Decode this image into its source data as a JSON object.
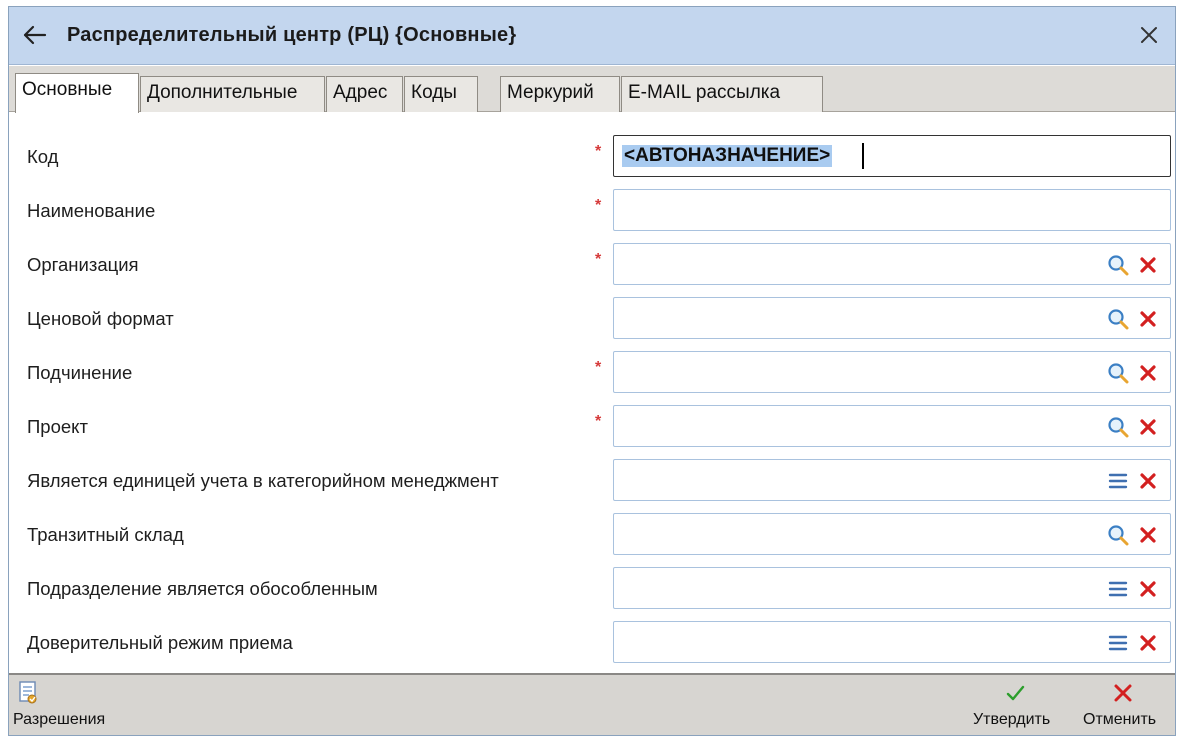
{
  "window": {
    "title": "Распределительный центр (РЦ) {Основные}",
    "back_icon": "arrow-left-icon",
    "close_icon": "close-icon"
  },
  "tabs": [
    {
      "label": "Основные",
      "active": true
    },
    {
      "label": "Дополнительные",
      "active": false
    },
    {
      "label": "Адрес",
      "active": false
    },
    {
      "label": "Коды",
      "active": false
    },
    {
      "label": "Меркурий",
      "active": false
    },
    {
      "label": "E-MAIL рассылка",
      "active": false
    }
  ],
  "form": {
    "required_mark": "*",
    "fields": [
      {
        "label": "Код",
        "required": true,
        "value": "<АВТОНАЗНАЧЕНИЕ>",
        "icon": "none"
      },
      {
        "label": "Наименование",
        "required": true,
        "value": "",
        "icon": "none"
      },
      {
        "label": "Организация",
        "required": true,
        "value": "",
        "icon": "search-icon"
      },
      {
        "label": "Ценовой формат",
        "required": false,
        "value": "",
        "icon": "search-icon"
      },
      {
        "label": "Подчинение",
        "required": true,
        "value": "",
        "icon": "search-icon"
      },
      {
        "label": "Проект",
        "required": true,
        "value": "",
        "icon": "search-icon"
      },
      {
        "label": "Является единицей учета в категорийном менеджмент",
        "required": false,
        "value": "",
        "icon": "list-icon"
      },
      {
        "label": "Транзитный склад",
        "required": false,
        "value": "",
        "icon": "search-icon"
      },
      {
        "label": "Подразделение является обособленным",
        "required": false,
        "value": "",
        "icon": "list-icon"
      },
      {
        "label": "Доверительный режим приема",
        "required": false,
        "value": "",
        "icon": "list-icon"
      }
    ]
  },
  "footer": {
    "permissions_label": "Разрешения",
    "permissions_icon": "permissions-icon",
    "approve_label": "Утвердить",
    "approve_icon": "checkmark-icon",
    "cancel_label": "Отменить",
    "cancel_icon": "cancel-x-icon"
  },
  "colors": {
    "titlebar_bg": "#c3d6ee",
    "tabstrip_bg": "#dddbd7",
    "field_border": "#a9c2de",
    "required_red": "#d63a3a",
    "clear_red": "#d32020",
    "approve_green": "#2c9e2c",
    "selection_bg": "#a9cbf0"
  }
}
